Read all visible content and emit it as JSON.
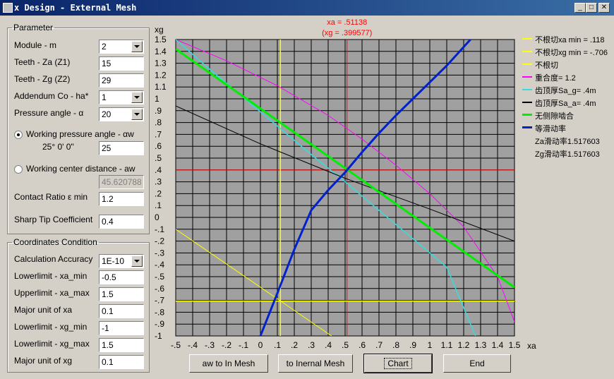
{
  "window": {
    "title": "x Design - External Mesh",
    "minimize": "_",
    "maximize": "□",
    "close": "✕"
  },
  "parameter": {
    "legend": "Parameter",
    "module_label": "Module - m",
    "module_value": "2",
    "teeth_za_label": "Teeth - Za (Z1)",
    "teeth_za_value": "15",
    "teeth_zg_label": "Teeth - Zg (Z2)",
    "teeth_zg_value": "29",
    "addendum_label": "Addendum Co - ha*",
    "addendum_value": "1",
    "pressure_label": "Pressure angle - α",
    "pressure_value": "20",
    "working_pressure_label": "Working pressure angle - αw",
    "working_pressure_sub": "25° 0' 0\"",
    "working_pressure_value": "25",
    "working_center_label": "Working center distance - aw",
    "working_center_value": "45.620788",
    "contact_ratio_label": "Contact Ratio ε min",
    "contact_ratio_value": "1.2",
    "sharp_tip_label": "Sharp Tip Coefficient",
    "sharp_tip_value": "0.4"
  },
  "coords": {
    "legend": "Coordinates Condition",
    "accuracy_label": "Calculation Accuracy",
    "accuracy_value": "1E-10",
    "xa_min_label": "Lowerlimit - xa_min",
    "xa_min_value": "-0.5",
    "xa_max_label": "Upperlimit - xa_max",
    "xa_max_value": "1.5",
    "xa_major_label": "Major unit of xa",
    "xa_major_value": "0.1",
    "xg_min_label": "Lowerlimit - xg_min",
    "xg_min_value": "-1",
    "xg_max_label": "Lowerlimit - xg_max",
    "xg_max_value": "1.5",
    "xg_major_label": "Major unit of xg",
    "xg_major_value": "0.1"
  },
  "buttons": {
    "aw_in_mesh": "aw to In Mesh",
    "to_internal": "to Inernal Mesh",
    "chart": "Chart",
    "end": "End"
  },
  "legend": [
    {
      "text": "不根切xa min = .118",
      "color": "#ffff00"
    },
    {
      "text": "不根切xg min = -.706",
      "color": "#ffff00"
    },
    {
      "text": "不根切",
      "color": "#ffff00"
    },
    {
      "text": "重合度= 1.2",
      "color": "#ff00ff"
    },
    {
      "text": "齿顶厚Sa_g= .4m",
      "color": "#33dddd"
    },
    {
      "text": "齿顶厚Sa_a= .4m",
      "color": "#000000"
    },
    {
      "text": "无侧隙啮合",
      "color": "#00ee00"
    },
    {
      "text": "等滑动率",
      "color": "#0022cc"
    },
    {
      "text": "Za滑动率1.517603",
      "color": ""
    },
    {
      "text": "Zg滑动率1.517603",
      "color": ""
    }
  ],
  "chart_data": {
    "type": "line",
    "xlabel": "xa",
    "ylabel": "xg",
    "xlim": [
      -0.5,
      1.5
    ],
    "ylim": [
      -1,
      1.5
    ],
    "x_ticks": [
      "-.5",
      "-.4",
      "-.3",
      "-.2",
      "-.1",
      "0",
      ".1",
      ".2",
      ".3",
      ".4",
      ".5",
      ".6",
      ".7",
      ".8",
      ".9",
      "1",
      "1.1",
      "1.2",
      "1.3",
      "1.4",
      "1.5"
    ],
    "y_ticks": [
      "1.5",
      "1.4",
      "1.3",
      "1.2",
      "1.1",
      "1",
      ".9",
      ".8",
      ".7",
      ".6",
      ".5",
      ".4",
      ".3",
      ".2",
      ".1",
      "0",
      "-.1",
      "-.2",
      "-.3",
      "-.4",
      "-.5",
      "-.6",
      "-.7",
      "-.8",
      "-.9",
      "-1"
    ],
    "cursor": {
      "xa_label": "xa = .51138",
      "xg_label": "(xg = .399577)",
      "xa": 0.51138,
      "xg": 0.399577
    },
    "series": [
      {
        "name": "不根切xa min = .118",
        "color": "#ffff00",
        "width": 1.5,
        "x": [
          0.118,
          0.118
        ],
        "y": [
          -1,
          1.5
        ]
      },
      {
        "name": "不根切xg min = -.706",
        "color": "#ffff00",
        "width": 1.5,
        "x": [
          -0.5,
          1.5
        ],
        "y": [
          -0.706,
          -0.706
        ]
      },
      {
        "name": "不根切",
        "color": "#ffff00",
        "width": 1,
        "x": [
          -0.5,
          0.42
        ],
        "y": [
          -0.1,
          -1
        ]
      },
      {
        "name": "重合度= 1.2",
        "color": "#ff00ff",
        "width": 1,
        "x": [
          -0.5,
          -0.2,
          0.1,
          0.4,
          0.6,
          0.8,
          1.0,
          1.2,
          1.4,
          1.5
        ],
        "y": [
          1.5,
          1.32,
          1.11,
          0.86,
          0.66,
          0.44,
          0.2,
          -0.08,
          -0.5,
          -0.88
        ]
      },
      {
        "name": "齿顶厚Sa_g= .4m",
        "color": "#33dddd",
        "width": 1.5,
        "x": [
          -0.5,
          -0.3,
          -0.1,
          0.1,
          0.3,
          0.5,
          0.7,
          0.9,
          1.1,
          1.27
        ],
        "y": [
          1.5,
          1.25,
          1.01,
          0.77,
          0.53,
          0.3,
          0.06,
          -0.18,
          -0.42,
          -1
        ]
      },
      {
        "name": "齿顶厚Sa_a= .4m",
        "color": "#000000",
        "width": 1,
        "x": [
          -0.5,
          0.0,
          0.5,
          1.0,
          1.5
        ],
        "y": [
          0.94,
          0.62,
          0.33,
          0.07,
          -0.2
        ]
      },
      {
        "name": "无侧隙啮合",
        "color": "#00ee00",
        "width": 3,
        "x": [
          -0.5,
          1.5
        ],
        "y": [
          1.42,
          -0.59
        ]
      },
      {
        "name": "等滑动率",
        "color": "#0022cc",
        "width": 3,
        "x": [
          0.0,
          0.1,
          0.2,
          0.3,
          0.4,
          0.5,
          0.6,
          0.7,
          0.8,
          0.9,
          1.0,
          1.1,
          1.24
        ],
        "y": [
          -1,
          -0.64,
          -0.27,
          0.06,
          0.23,
          0.38,
          0.55,
          0.71,
          0.86,
          1.0,
          1.14,
          1.28,
          1.5
        ]
      }
    ]
  }
}
